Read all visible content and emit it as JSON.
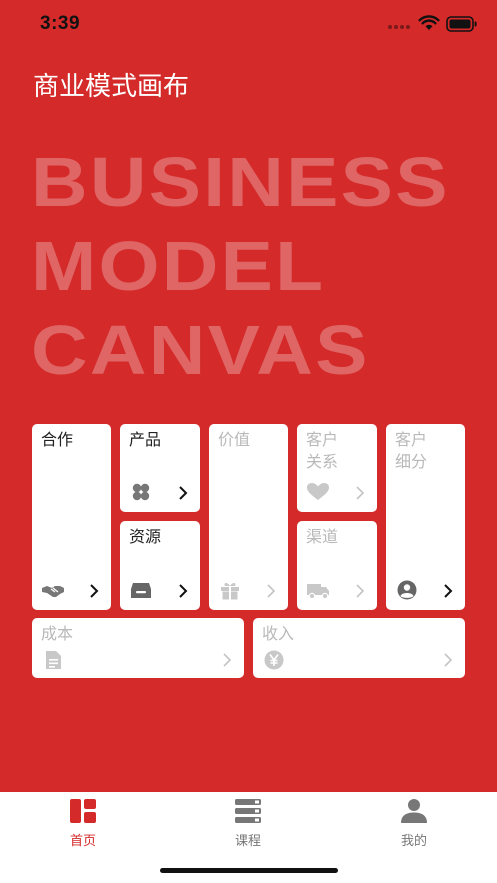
{
  "status_bar": {
    "time": "3:39"
  },
  "page": {
    "title": "商业模式画布"
  },
  "background_words": [
    "BUSINESS",
    "MODEL",
    "CANVAS"
  ],
  "canvas_blocks": {
    "partners": {
      "label": "合作",
      "icon": "handshake-icon"
    },
    "products": {
      "label": "产品",
      "icon": "clover-icon"
    },
    "value": {
      "label": "价值",
      "icon": "gift-icon"
    },
    "customer_relations": {
      "label": "客户\n关系",
      "icon": "heart-icon"
    },
    "customer_segments": {
      "label": "客户\n细分",
      "icon": "person-circle-icon"
    },
    "resources": {
      "label": "资源",
      "icon": "inbox-icon"
    },
    "channels": {
      "label": "渠道",
      "icon": "truck-icon"
    },
    "cost": {
      "label": "成本",
      "icon": "document-icon"
    },
    "revenue": {
      "label": "收入",
      "icon": "yen-coin-icon"
    }
  },
  "tab_bar": {
    "tabs": [
      {
        "label": "首页",
        "icon": "dashboard-icon",
        "active": true
      },
      {
        "label": "课程",
        "icon": "books-icon",
        "active": false
      },
      {
        "label": "我的",
        "icon": "user-icon",
        "active": false
      }
    ]
  },
  "colors": {
    "brand_red": "#d42a2a",
    "card_bg": "#ffffff",
    "inactive_gray": "#b9b9b9"
  }
}
